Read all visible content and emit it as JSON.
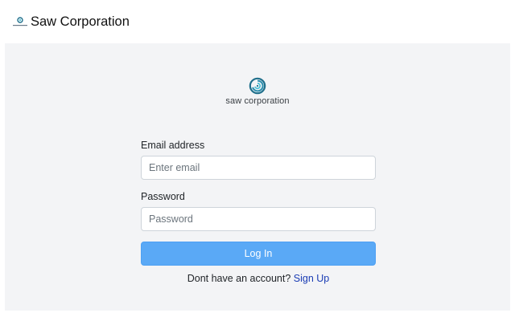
{
  "header": {
    "brand_name": "Saw Corporation",
    "logo_icon": "saw-corporation-logo-small"
  },
  "logo": {
    "icon": "swirl-logo",
    "text": "saw corporation",
    "color_primary": "#1f6f8b",
    "color_accent": "#4fc3d9"
  },
  "form": {
    "email_label": "Email address",
    "email_placeholder": "Enter email",
    "email_value": "",
    "password_label": "Password",
    "password_placeholder": "Password",
    "password_value": "",
    "login_button": "Log In",
    "signup_prompt": "Dont have an account?",
    "signup_link": "Sign Up"
  },
  "colors": {
    "button_bg": "#5aa9f6",
    "link": "#1a3cb4",
    "page_bg": "#f3f4f6"
  }
}
